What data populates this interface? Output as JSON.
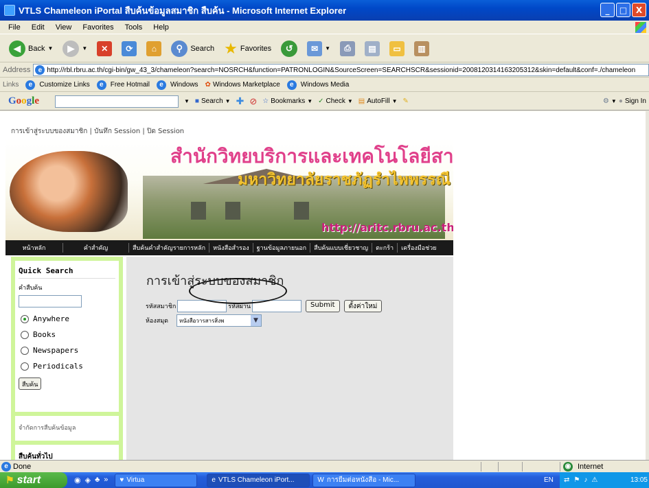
{
  "window": {
    "title": "VTLS Chameleon iPortal สืบค้นข้อมูลสมาชิก สืบค้น - Microsoft Internet Explorer",
    "buttons": {
      "minimize": "_",
      "maximize": "□",
      "close": "X"
    }
  },
  "menu": [
    "File",
    "Edit",
    "View",
    "Favorites",
    "Tools",
    "Help"
  ],
  "toolbar": {
    "back": "Back",
    "search": "Search",
    "favorites": "Favorites"
  },
  "address": {
    "label": "Address",
    "url": "http://rbl.rbru.ac.th/cgi-bin/gw_43_3/chameleon?search=NOSRCH&function=PATRONLOGIN&SourceScreen=SEARCHSCR&sessionid=2008120314163205312&skin=default&conf=./chameleon"
  },
  "links": {
    "label": "Links",
    "items": [
      "Customize Links",
      "Free Hotmail",
      "Windows",
      "Windows Marketplace",
      "Windows Media"
    ]
  },
  "google_bar": {
    "logo": "Google",
    "search": "Search",
    "bookmarks": "Bookmarks",
    "check": "Check",
    "autofill": "AutoFill",
    "signin": "Sign In"
  },
  "page": {
    "top_links": [
      "การเข้าสู่ระบบของสมาชิก",
      "บันทึก Session",
      "ปิด Session"
    ],
    "banner": {
      "title_th": "สำนักวิทยบริการและเทคโนโลยีสารสนเทศ",
      "subtitle_th": "มหาวิทยาลัยราชภัฏรำไพพรรณี",
      "url": "http://aritc.rbru.ac.th"
    },
    "nav": [
      "หน้าหลัก",
      "คำสำคัญ",
      "สืบค้นคำสำคัญรายการหลัก",
      "หนังสือสำรอง",
      "ฐานข้อมูลภายนอก",
      "สืบค้นแบบเชี่ยวชาญ",
      "ตะกร้า",
      "เครื่องมือช่วย"
    ],
    "quick_search": {
      "title": "Quick Search",
      "label": "คำสืบค้น",
      "options": [
        "Anywhere",
        "Books",
        "Newspapers",
        "Periodicals"
      ],
      "selected": "Anywhere",
      "button": "สืบค้น"
    },
    "limit_label": "จำกัดการสืบค้นข้อมูล",
    "general_label": "สืบค้นทั่วไป",
    "login": {
      "heading": "การเข้าสู่ระบบของสมาชิก",
      "member_id_label": "รหัสสมาชิก",
      "password_label": "รหัสผ่าน",
      "submit": "Submit",
      "reset": "ตั้งค่าใหม่",
      "library_label": "ห้องสมุด",
      "library_value": "หนังสือวารสารสิ่งพ"
    }
  },
  "status": {
    "text": "Done",
    "zone": "Internet"
  },
  "taskbar": {
    "start": "start",
    "tasks": [
      "Virtua",
      "VTLS Chameleon iPort...",
      "การยืมต่อหนังสือ - Mic..."
    ],
    "lang": "EN",
    "clock": "13:05"
  }
}
